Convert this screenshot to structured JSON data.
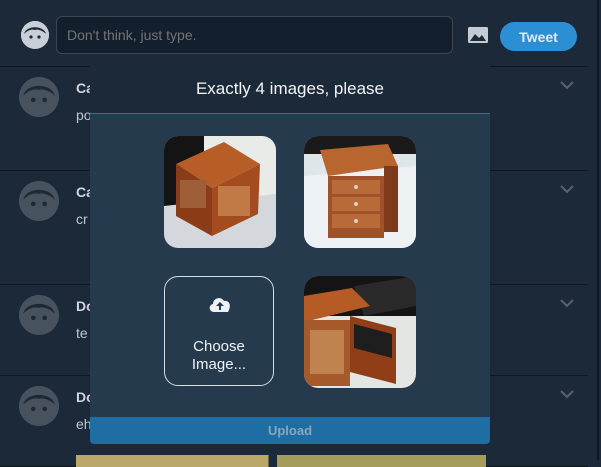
{
  "compose": {
    "placeholder": "Don't think, just type.",
    "tweet_label": "Tweet"
  },
  "feed": {
    "posts": [
      {
        "name": "Ca",
        "text": "po"
      },
      {
        "name": "Ca",
        "text": "cr"
      },
      {
        "name": "Do",
        "text": "te"
      },
      {
        "name": "Do",
        "text": "eh"
      }
    ]
  },
  "modal": {
    "title": "Exactly 4 images, please",
    "choose_label_1": "Choose",
    "choose_label_2": "Image...",
    "upload_label": "Upload"
  },
  "icons": {
    "avatar": "face-icon",
    "image": "image-icon",
    "chevron": "chevron-down-icon",
    "upload": "cloud-upload-icon"
  },
  "colors": {
    "accent": "#2d8fd3",
    "background": "#1c2938",
    "modal": "#263a4d"
  }
}
